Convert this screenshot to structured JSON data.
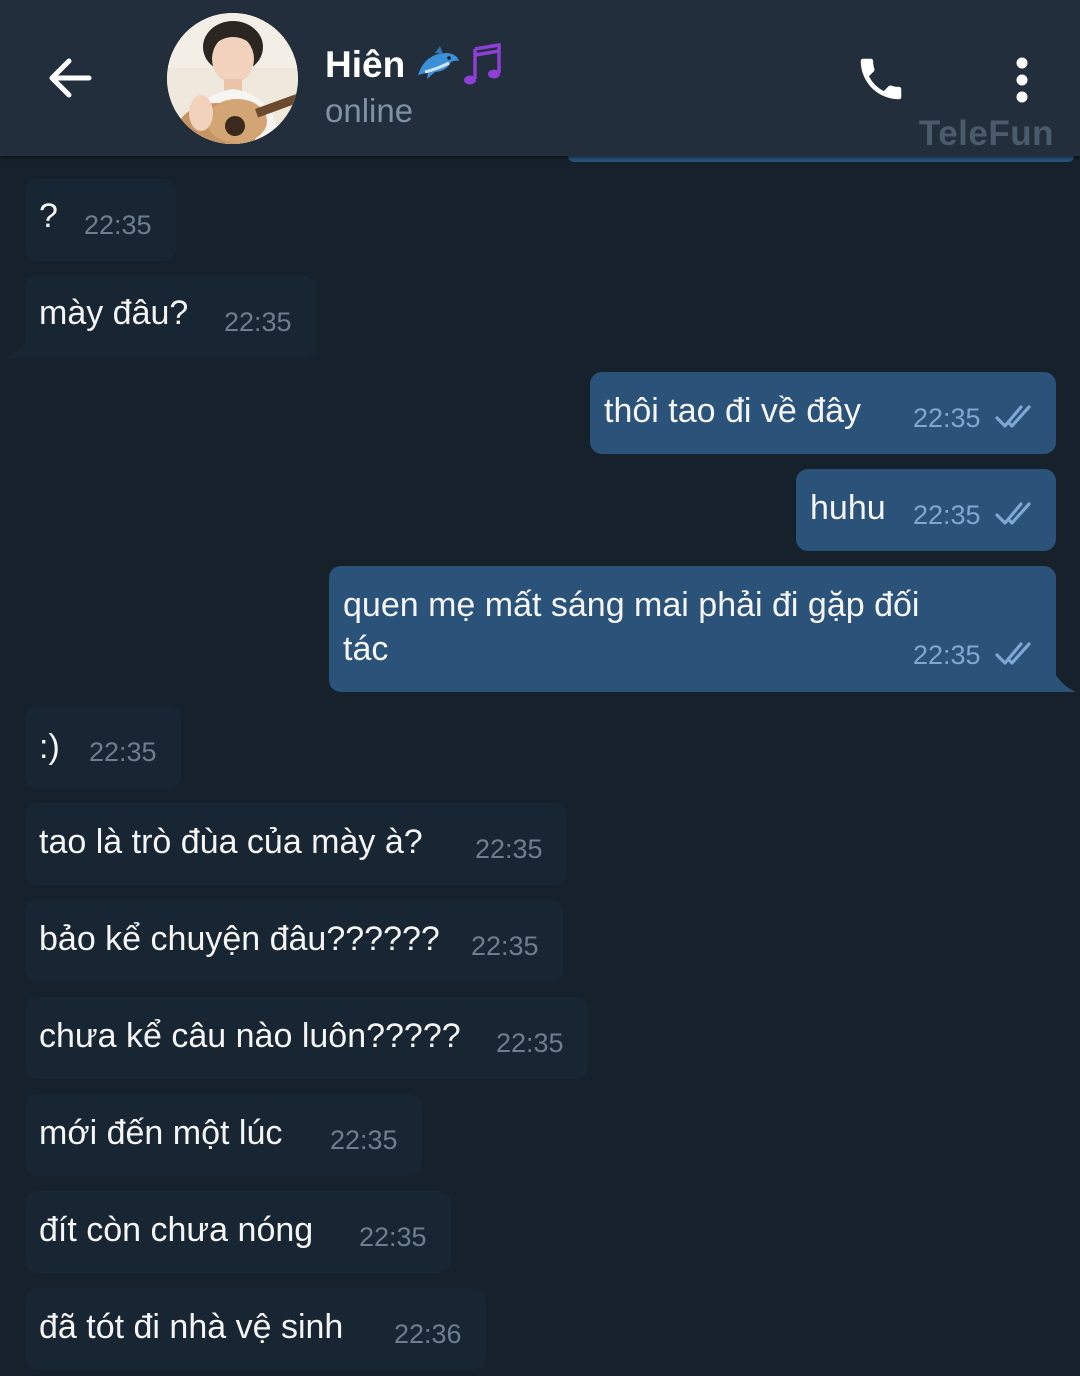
{
  "header": {
    "contact_name": "Hiên",
    "status": "online",
    "watermark": "TeleFun",
    "back_icon": "arrow-left-icon",
    "call_icon": "phone-icon",
    "menu_icon": "more-vertical-icon",
    "name_emoji": "🐬🎶"
  },
  "colors": {
    "background": "#17212b",
    "header": "#232e3c",
    "incoming_bubble": "#182533",
    "outgoing_bubble": "#2b5278",
    "read_ticks": "#7da8d3"
  },
  "messages": [
    {
      "direction": "incoming",
      "text": "?",
      "time": "22:35"
    },
    {
      "direction": "incoming",
      "text": "mày đâu?",
      "time": "22:35"
    },
    {
      "direction": "outgoing",
      "text": "thôi tao đi về đây",
      "time": "22:35",
      "status": "read"
    },
    {
      "direction": "outgoing",
      "text": "huhu",
      "time": "22:35",
      "status": "read"
    },
    {
      "direction": "outgoing",
      "text_line1": "quen mẹ mất sáng mai phải đi gặp đối",
      "text_line2": "tác",
      "time": "22:35",
      "status": "read"
    },
    {
      "direction": "incoming",
      "text": ":)",
      "time": "22:35"
    },
    {
      "direction": "incoming",
      "text": "tao là trò đùa của mày à?",
      "time": "22:35"
    },
    {
      "direction": "incoming",
      "text": "bảo kể chuyện đâu??????",
      "time": "22:35"
    },
    {
      "direction": "incoming",
      "text": "chưa kể câu nào luôn?????",
      "time": "22:35"
    },
    {
      "direction": "incoming",
      "text": "mới đến một lúc",
      "time": "22:35"
    },
    {
      "direction": "incoming",
      "text": "đít còn chưa nóng",
      "time": "22:35"
    },
    {
      "direction": "incoming",
      "text": "đã tót đi nhà vệ sinh",
      "time": "22:36"
    }
  ]
}
